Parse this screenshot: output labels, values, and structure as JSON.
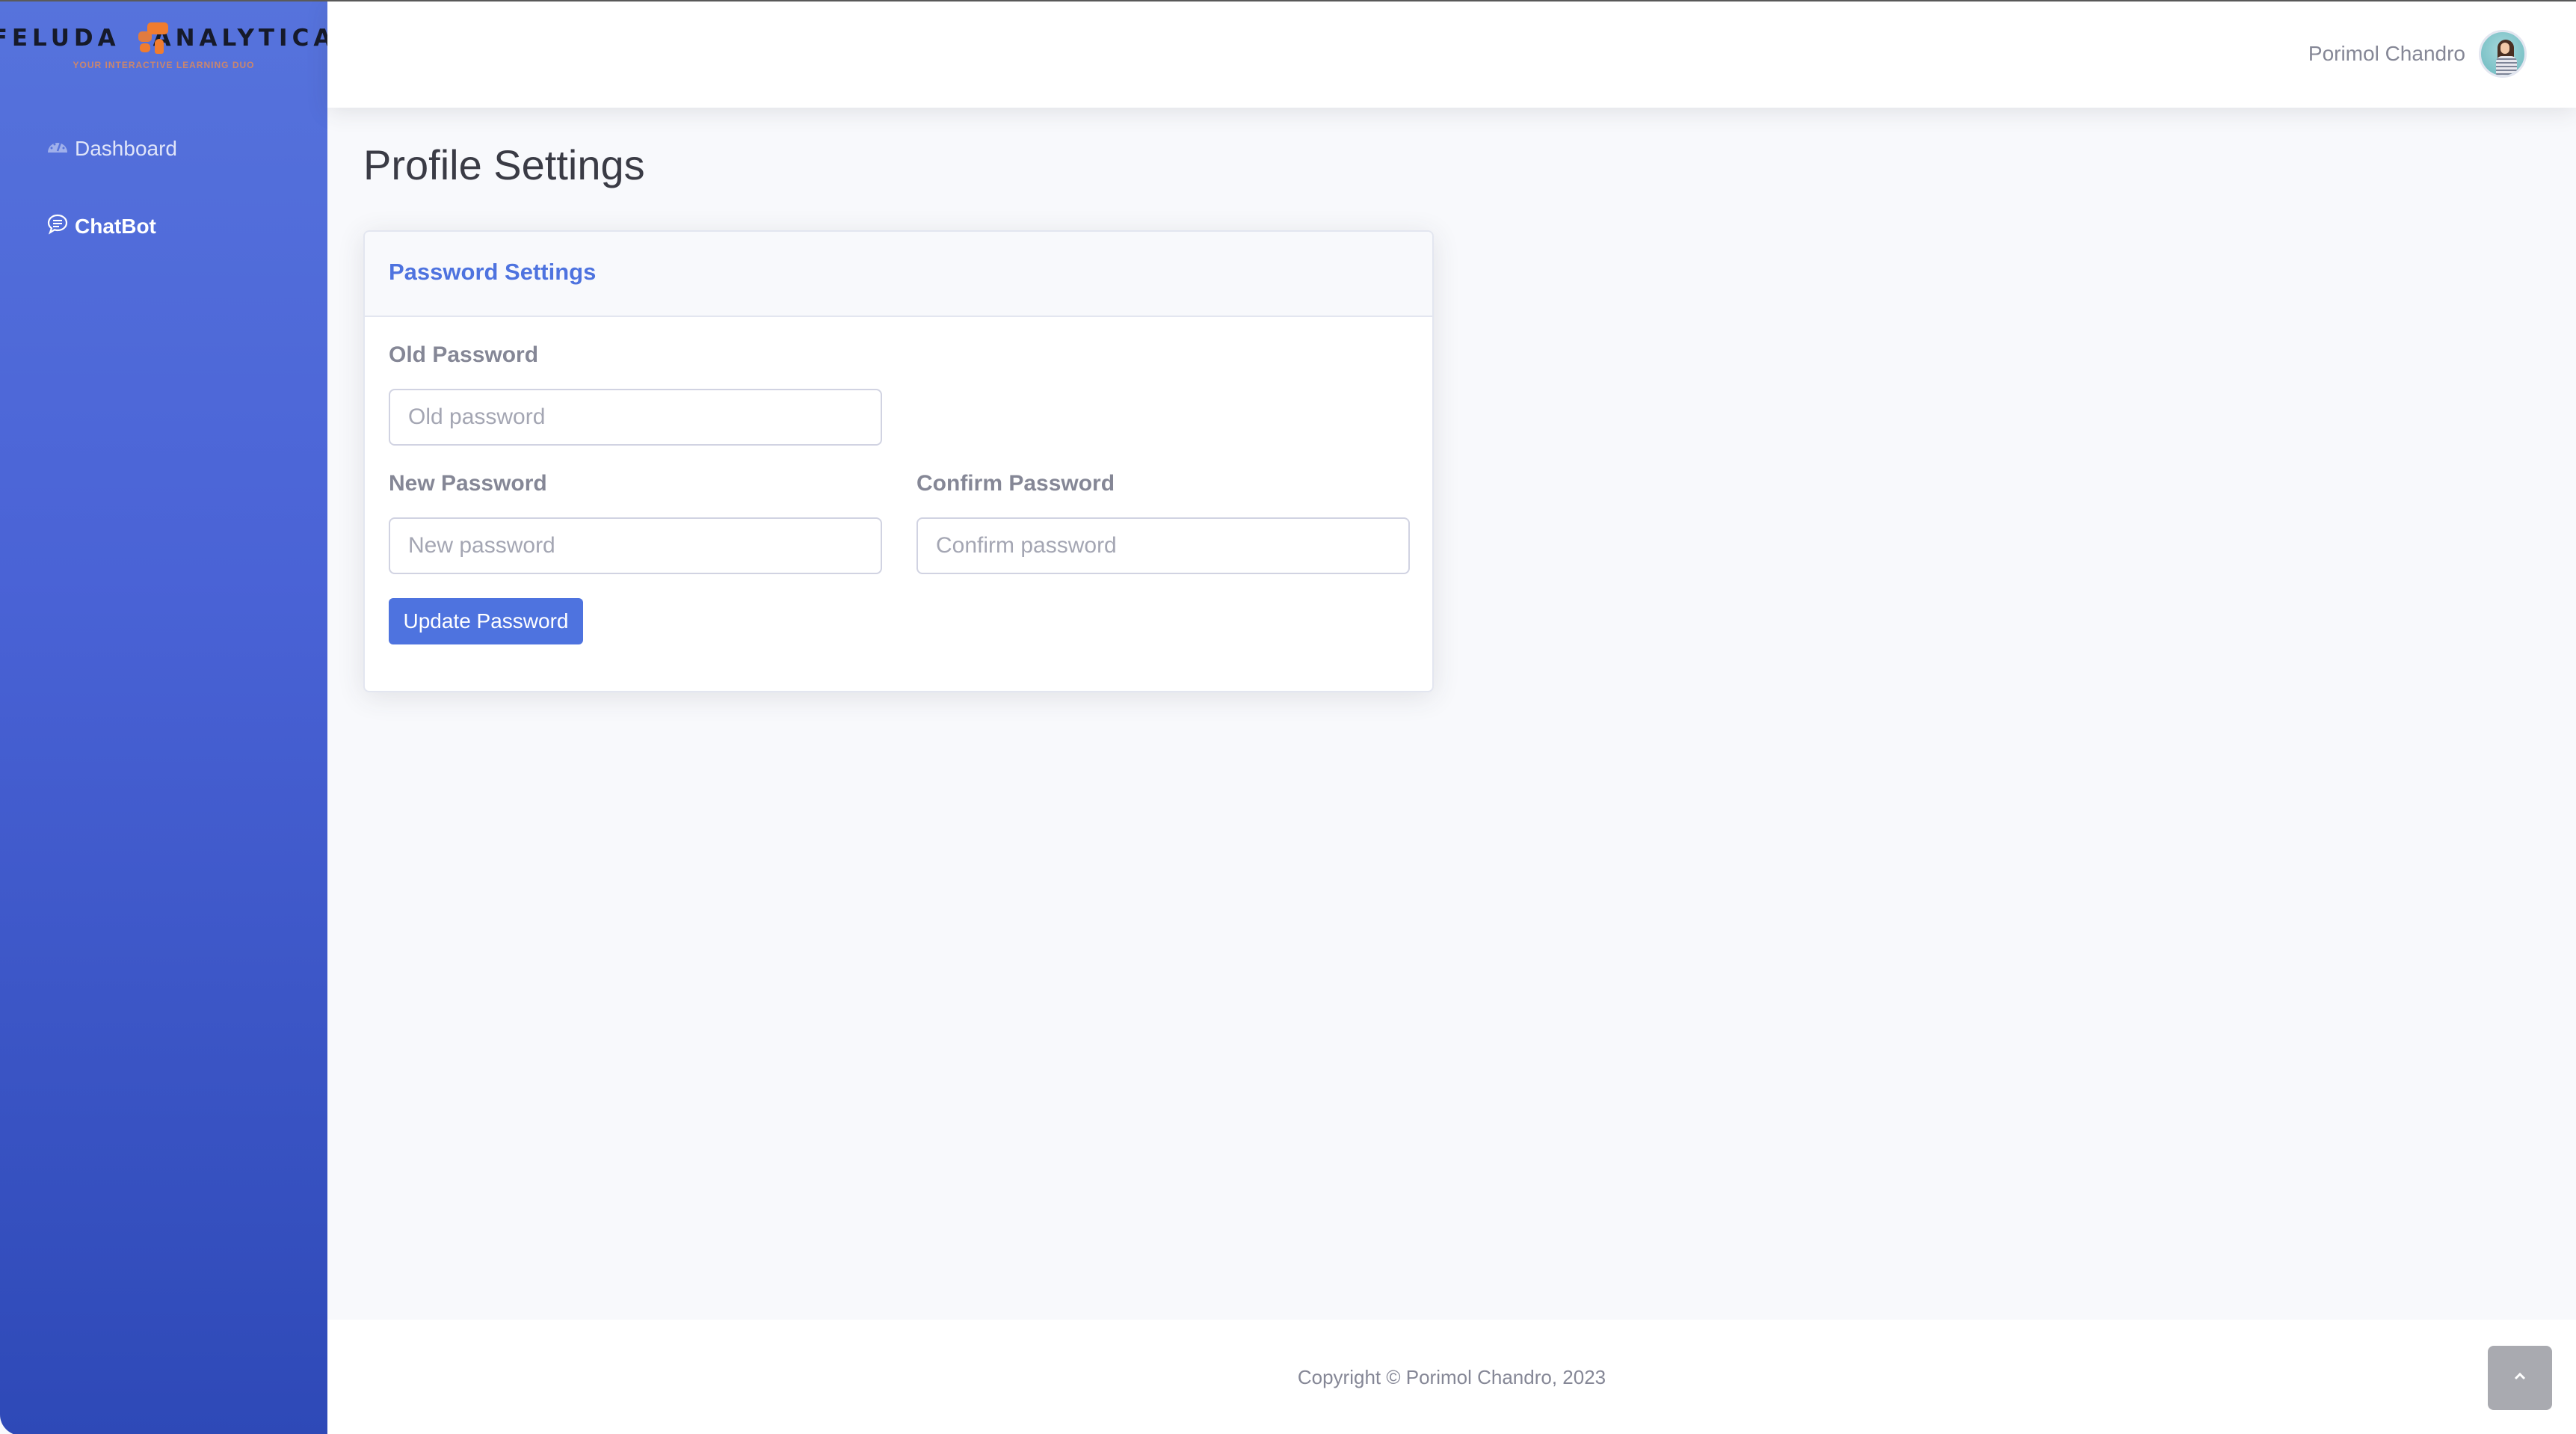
{
  "brand": {
    "name_left": "FELUDA",
    "name_right": "ANALYTICA",
    "tagline": "YOUR INTERACTIVE LEARNING DUO",
    "logo_icon": "chat-bubbles-icon"
  },
  "sidebar": {
    "items": [
      {
        "label": "Dashboard",
        "icon": "tachometer-icon",
        "active": false
      },
      {
        "label": "ChatBot",
        "icon": "chat-bubble-icon",
        "active": true
      }
    ]
  },
  "topbar": {
    "user_name": "Porimol Chandro",
    "avatar": "user-avatar-photo"
  },
  "page": {
    "title": "Profile Settings"
  },
  "password_card": {
    "title": "Password Settings",
    "old_password": {
      "label": "Old Password",
      "placeholder": "Old password",
      "value": ""
    },
    "new_password": {
      "label": "New Password",
      "placeholder": "New password",
      "value": ""
    },
    "confirm_password": {
      "label": "Confirm Password",
      "placeholder": "Confirm password",
      "value": ""
    },
    "submit_label": "Update Password"
  },
  "footer": {
    "copyright": "Copyright © Porimol Chandro, 2023"
  },
  "scroll_top": {
    "icon": "chevron-up-icon"
  },
  "colors": {
    "primary": "#4e73df",
    "sidebar_top": "#5673dc",
    "sidebar_bottom": "#2e49b7",
    "brand_accent": "#f07c2f",
    "text_muted": "#858796"
  }
}
